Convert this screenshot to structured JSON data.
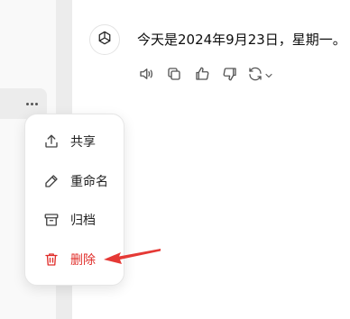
{
  "chat": {
    "message": "今天是2024年9月23日，星期一。",
    "assistant_icon": "openai-logo-icon",
    "actions": [
      {
        "name": "read-aloud-button",
        "icon": "speaker-icon"
      },
      {
        "name": "copy-button",
        "icon": "copy-icon"
      },
      {
        "name": "thumbs-up-button",
        "icon": "thumbs-up-icon"
      },
      {
        "name": "thumbs-down-button",
        "icon": "thumbs-down-icon"
      },
      {
        "name": "regenerate-button",
        "icon": "refresh-icon"
      }
    ]
  },
  "context_menu": {
    "items": [
      {
        "label": "共享",
        "icon": "share-icon"
      },
      {
        "label": "重命名",
        "icon": "pencil-icon"
      },
      {
        "label": "归档",
        "icon": "archive-icon"
      },
      {
        "label": "删除",
        "icon": "trash-icon"
      }
    ]
  },
  "colors": {
    "danger": "#e02e2a",
    "arrow": "#e53935"
  }
}
